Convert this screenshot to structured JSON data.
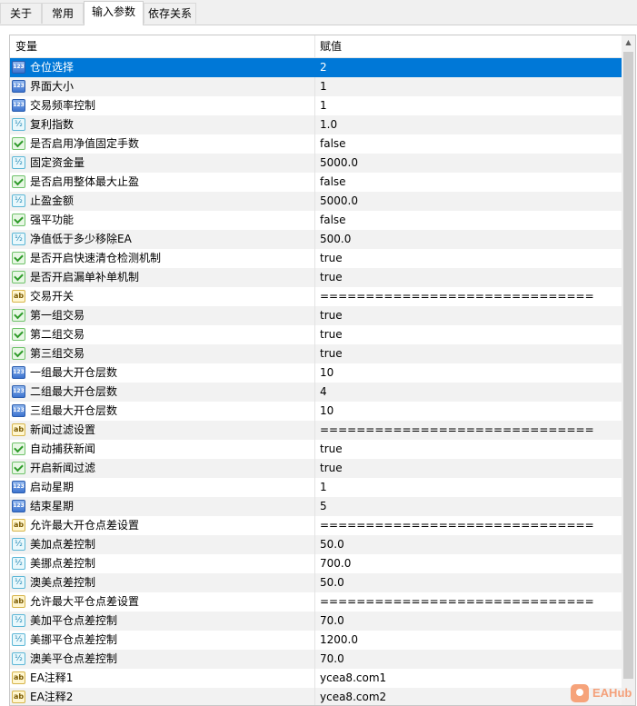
{
  "tabs": [
    {
      "label": "关于",
      "active": false
    },
    {
      "label": "常用",
      "active": false
    },
    {
      "label": "输入参数",
      "active": true
    },
    {
      "label": "依存关系",
      "active": false
    }
  ],
  "table": {
    "columns": {
      "name": "变量",
      "value": "赋值"
    },
    "selected_index": 0,
    "rows": [
      {
        "icon": "int-icon",
        "name": "仓位选择",
        "value": "2"
      },
      {
        "icon": "int-icon",
        "name": "界面大小",
        "value": "1"
      },
      {
        "icon": "int-icon",
        "name": "交易频率控制",
        "value": "1"
      },
      {
        "icon": "double-icon",
        "name": "复利指数",
        "value": "1.0"
      },
      {
        "icon": "bool-icon",
        "name": "是否启用净值固定手数",
        "value": "false"
      },
      {
        "icon": "double-icon",
        "name": "固定资金量",
        "value": "5000.0"
      },
      {
        "icon": "bool-icon",
        "name": "是否启用整体最大止盈",
        "value": "false"
      },
      {
        "icon": "double-icon",
        "name": "止盈金额",
        "value": "5000.0"
      },
      {
        "icon": "bool-icon",
        "name": "强平功能",
        "value": "false"
      },
      {
        "icon": "double-icon",
        "name": "净值低于多少移除EA",
        "value": "500.0"
      },
      {
        "icon": "bool-icon",
        "name": "是否开启快速清仓检测机制",
        "value": "true"
      },
      {
        "icon": "bool-icon",
        "name": "是否开启漏单补单机制",
        "value": "true"
      },
      {
        "icon": "string-icon",
        "name": "交易开关",
        "value": "=============================="
      },
      {
        "icon": "bool-icon",
        "name": "第一组交易",
        "value": "true"
      },
      {
        "icon": "bool-icon",
        "name": "第二组交易",
        "value": "true"
      },
      {
        "icon": "bool-icon",
        "name": "第三组交易",
        "value": "true"
      },
      {
        "icon": "int-icon",
        "name": "一组最大开仓层数",
        "value": "10"
      },
      {
        "icon": "int-icon",
        "name": "二组最大开仓层数",
        "value": "4"
      },
      {
        "icon": "int-icon",
        "name": "三组最大开仓层数",
        "value": "10"
      },
      {
        "icon": "string-icon",
        "name": "新闻过滤设置",
        "value": "=============================="
      },
      {
        "icon": "bool-icon",
        "name": "自动捕获新闻",
        "value": "true"
      },
      {
        "icon": "bool-icon",
        "name": "开启新闻过滤",
        "value": "true"
      },
      {
        "icon": "int-icon",
        "name": "启动星期",
        "value": "1"
      },
      {
        "icon": "int-icon",
        "name": "结束星期",
        "value": "5"
      },
      {
        "icon": "string-icon",
        "name": "允许最大开仓点差设置",
        "value": "=============================="
      },
      {
        "icon": "double-icon",
        "name": "美加点差控制",
        "value": "50.0"
      },
      {
        "icon": "double-icon",
        "name": "美挪点差控制",
        "value": "700.0"
      },
      {
        "icon": "double-icon",
        "name": "澳美点差控制",
        "value": "50.0"
      },
      {
        "icon": "string-icon",
        "name": "允许最大平仓点差设置",
        "value": "=============================="
      },
      {
        "icon": "double-icon",
        "name": "美加平仓点差控制",
        "value": "70.0"
      },
      {
        "icon": "double-icon",
        "name": "美挪平仓点差控制",
        "value": "1200.0"
      },
      {
        "icon": "double-icon",
        "name": "澳美平仓点差控制",
        "value": "70.0"
      },
      {
        "icon": "string-icon",
        "name": "EA注释1",
        "value": "ycea8.com1"
      },
      {
        "icon": "string-icon",
        "name": "EA注释2",
        "value": "ycea8.com2"
      }
    ]
  },
  "watermark": {
    "text": "EAHub"
  },
  "colors": {
    "selection": "#0078d7",
    "alt_row": "#f2f2f2",
    "watermark": "#f4a07a"
  }
}
